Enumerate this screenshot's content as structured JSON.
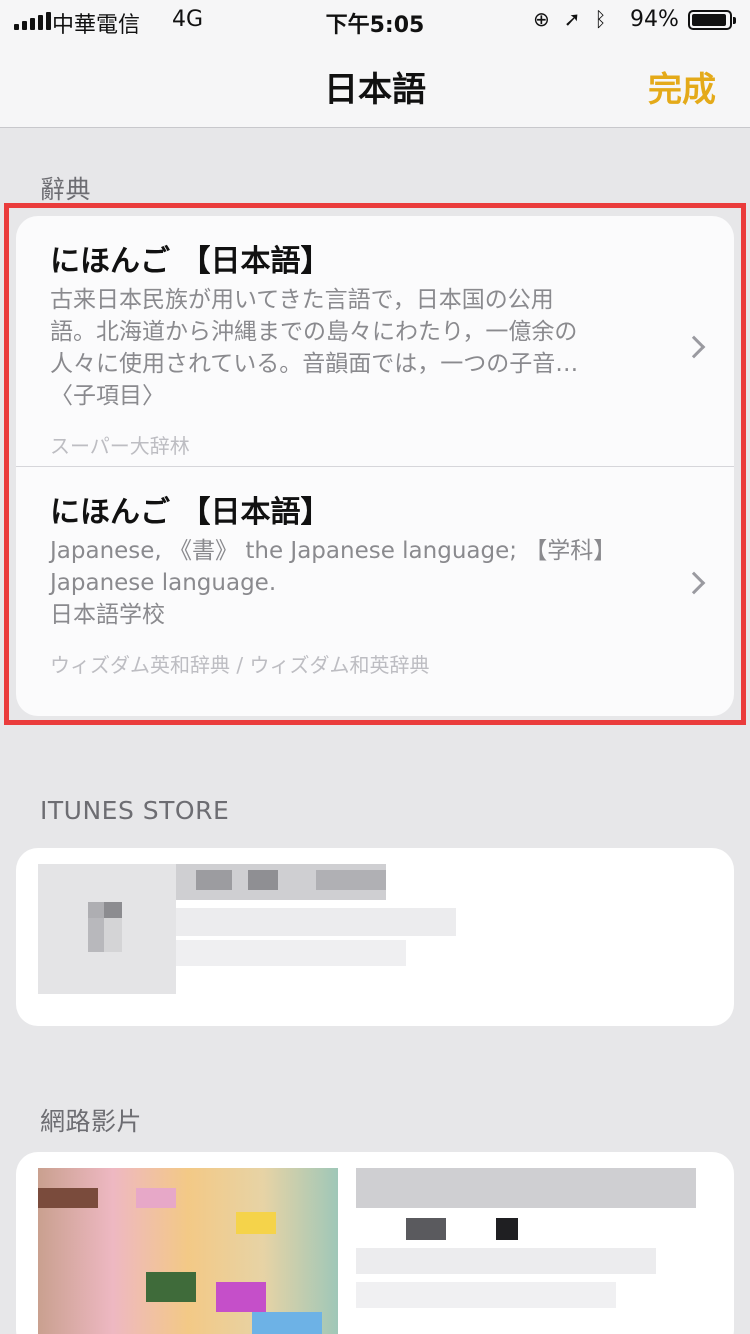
{
  "status_bar": {
    "carrier": "中華電信",
    "network": "4G",
    "time": "下午5:05",
    "battery_percent": "94%",
    "battery_level": 0.94,
    "icons": [
      "orientation-lock-icon",
      "location-icon",
      "bluetooth-icon"
    ]
  },
  "nav": {
    "title": "日本語",
    "done_label": "完成",
    "accent_color": "#e4aa19"
  },
  "sections": {
    "dictionary": {
      "header": "辭典",
      "entries": [
        {
          "headword": "にほんご 【日本語】",
          "definition_lines": [
            "古来日本民族が用いてきた言語で，日本国の公用",
            "語。北海道から沖縄までの島々にわたり，一億余の",
            "人々に使用されている。音韻面では，一つの子音…",
            "〈子項目〉"
          ],
          "source": "スーパー大辞林"
        },
        {
          "headword": "にほんご 【日本語】",
          "definition_lines": [
            "Japanese, 《書》 the Japanese language; 【学科】",
            "Japanese language.",
            "日本語学校"
          ],
          "source": "ウィズダム英和辞典 / ウィズダム和英辞典"
        }
      ]
    },
    "itunes": {
      "header": "ITUNES STORE"
    },
    "videos": {
      "header": "網路影片"
    }
  },
  "highlight_color": "#ea3c3c"
}
